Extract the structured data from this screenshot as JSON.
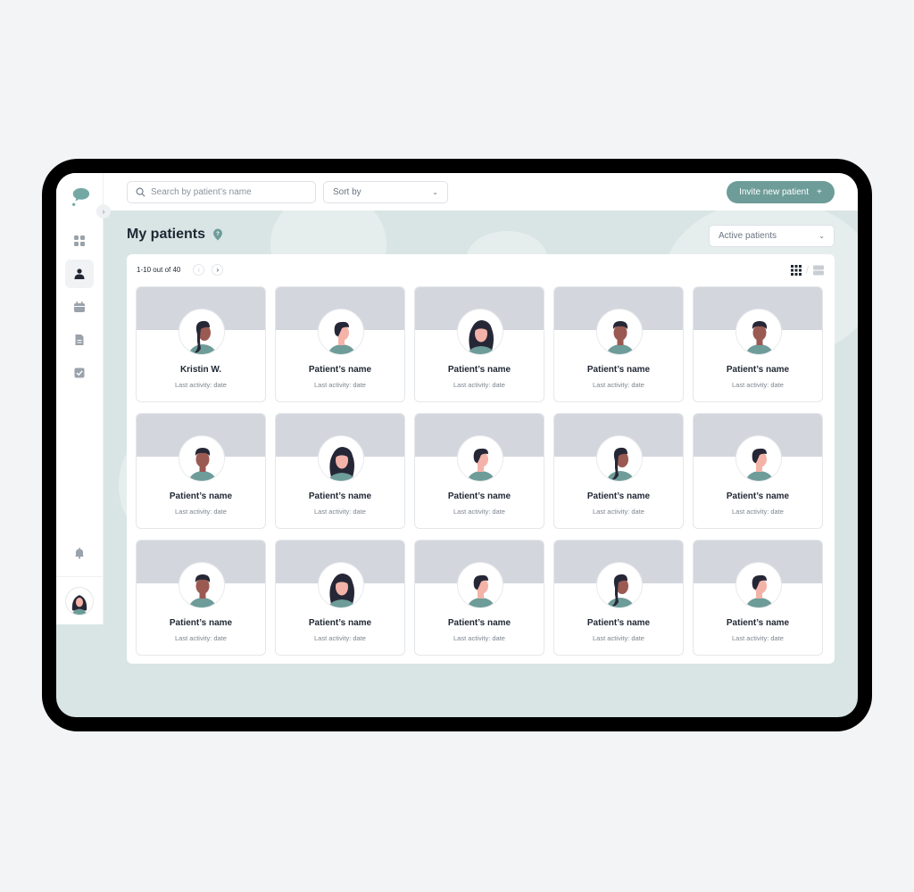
{
  "app": {
    "logo_icon": "speech-bubble-logo-icon"
  },
  "topbar": {
    "search_placeholder": "Search by patient’s name",
    "sort_label": "Sort by",
    "invite_label": "Invite new patient",
    "invite_icon": "+"
  },
  "sidebar": {
    "expand_icon": "›",
    "items": [
      {
        "name": "dashboard",
        "icon": "grid-icon",
        "active": false
      },
      {
        "name": "patients",
        "icon": "user-icon",
        "active": true
      },
      {
        "name": "calendar",
        "icon": "calendar-icon",
        "active": false
      },
      {
        "name": "documents",
        "icon": "document-icon",
        "active": false
      },
      {
        "name": "tasks",
        "icon": "checkbox-icon",
        "active": false
      }
    ],
    "notifications_icon": "bell-icon"
  },
  "main": {
    "title": "My patients",
    "filter_label": "Active patients",
    "pager": {
      "range_text": "1-10 out of 40",
      "prev": "‹",
      "next": "›"
    },
    "patients": [
      {
        "name": "Kristin W.",
        "activity": "Last activity: date",
        "avatar": "woman-ponytail-dark"
      },
      {
        "name": "Patient’s name",
        "activity": "Last activity: date",
        "avatar": "man-light"
      },
      {
        "name": "Patient’s name",
        "activity": "Last activity: date",
        "avatar": "woman-long-light"
      },
      {
        "name": "Patient’s name",
        "activity": "Last activity: date",
        "avatar": "man-dark"
      },
      {
        "name": "Patient’s name",
        "activity": "Last activity: date",
        "avatar": "man-dark"
      },
      {
        "name": "Patient’s name",
        "activity": "Last activity: date",
        "avatar": "man-dark"
      },
      {
        "name": "Patient’s name",
        "activity": "Last activity: date",
        "avatar": "woman-long-light"
      },
      {
        "name": "Patient’s name",
        "activity": "Last activity: date",
        "avatar": "man-light"
      },
      {
        "name": "Patient’s name",
        "activity": "Last activity: date",
        "avatar": "woman-ponytail-dark"
      },
      {
        "name": "Patient’s name",
        "activity": "Last activity: date",
        "avatar": "man-light"
      },
      {
        "name": "Patient’s name",
        "activity": "Last activity: date",
        "avatar": "man-dark"
      },
      {
        "name": "Patient’s name",
        "activity": "Last activity: date",
        "avatar": "woman-long-light"
      },
      {
        "name": "Patient’s name",
        "activity": "Last activity: date",
        "avatar": "man-light"
      },
      {
        "name": "Patient’s name",
        "activity": "Last activity: date",
        "avatar": "woman-ponytail-dark"
      },
      {
        "name": "Patient’s name",
        "activity": "Last activity: date",
        "avatar": "man-light"
      }
    ]
  },
  "colors": {
    "accent": "#6d9c99",
    "background": "#d8e5e4",
    "banner": "#d3d7dd",
    "text_dark": "#1f2733",
    "skin_light": "#f4b3a8",
    "skin_dark": "#9a5a52",
    "hair": "#262736",
    "shirt": "#6d9c99"
  }
}
